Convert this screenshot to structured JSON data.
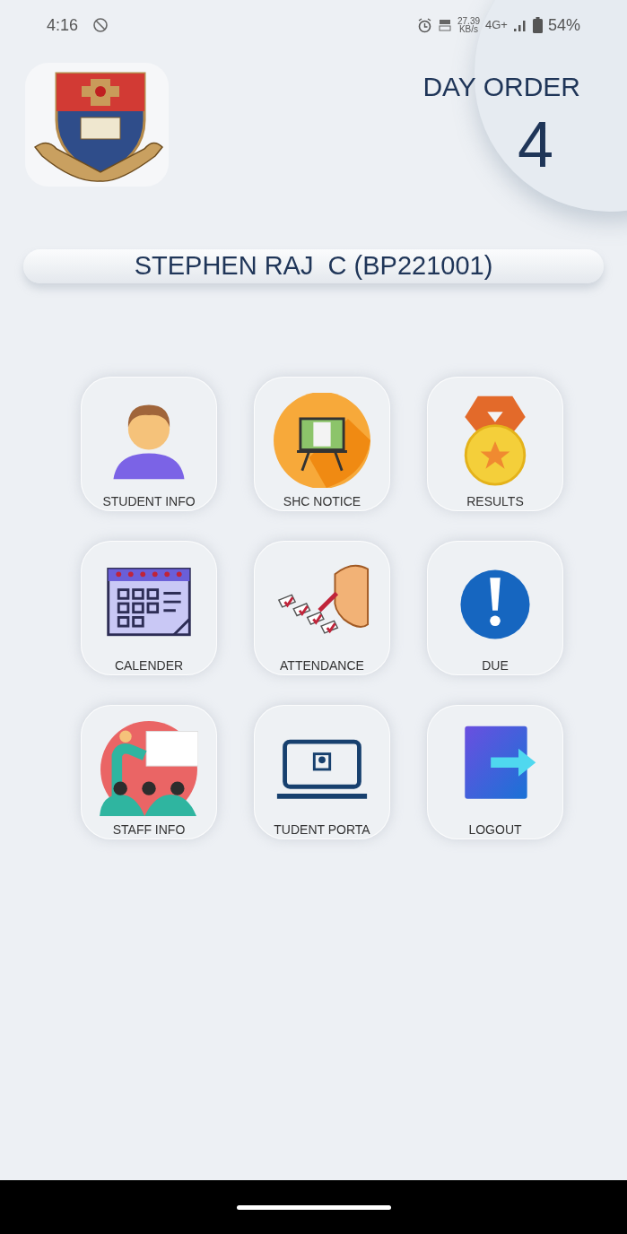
{
  "status_bar": {
    "time": "4:16",
    "speed": "27.39",
    "speed_unit": "KB/s",
    "network": "4G+",
    "battery": "54%"
  },
  "header": {
    "day_order_label": "DAY ORDER",
    "day_order": "4"
  },
  "user": {
    "name": "STEPHEN RAJ  C (BP221001)"
  },
  "menu": [
    {
      "kind": "student",
      "label": "STUDENT INFO"
    },
    {
      "kind": "notice",
      "label": "SHC NOTICE"
    },
    {
      "kind": "results",
      "label": "RESULTS"
    },
    {
      "kind": "calendar",
      "label": "CALENDER"
    },
    {
      "kind": "attendance",
      "label": "ATTENDANCE"
    },
    {
      "kind": "due",
      "label": "DUE"
    },
    {
      "kind": "staff",
      "label": "STAFF INFO"
    },
    {
      "kind": "portal",
      "label": "TUDENT PORTA"
    },
    {
      "kind": "logout",
      "label": "LOGOUT"
    }
  ]
}
